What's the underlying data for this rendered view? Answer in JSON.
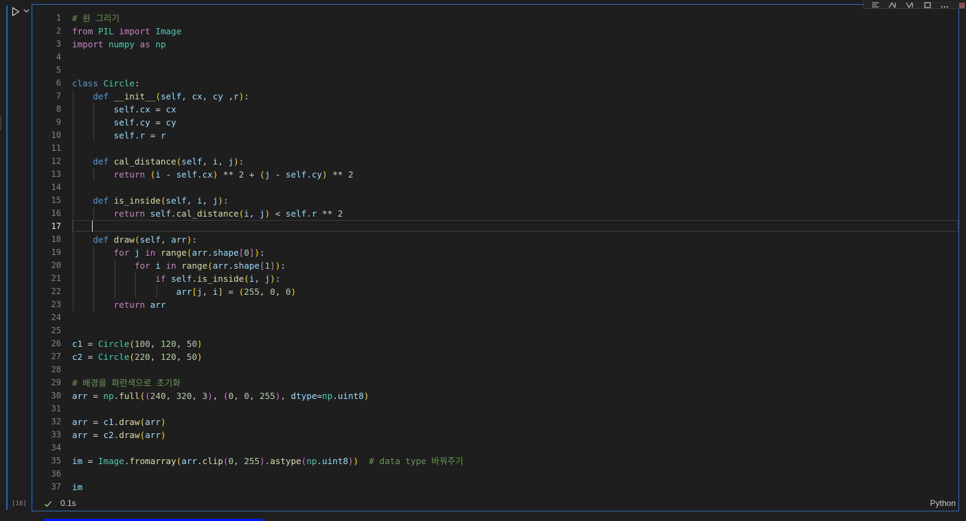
{
  "cell": {
    "execution_count": "[18]",
    "timing": "0.1s",
    "language": "Python",
    "active_line": 17
  },
  "toolbar": {
    "icons": [
      "run-by-line-icon",
      "execute-above-icon",
      "execute-below-icon",
      "split-cell-icon",
      "more-actions-icon",
      "delete-cell-icon"
    ]
  },
  "colors": {
    "accent": "#2f6fb5",
    "keyword": "#c586c0",
    "def": "#569cd6",
    "function": "#dcdcaa",
    "class": "#4ec9b0",
    "number": "#b5cea8",
    "comment": "#6a9955",
    "variable": "#9cdcfe",
    "success": "#89d185"
  },
  "code_lines": [
    [
      [
        "cm",
        "# 원 그리기"
      ]
    ],
    [
      [
        "kw",
        "from"
      ],
      [
        "op",
        " "
      ],
      [
        "cl",
        "PIL"
      ],
      [
        "op",
        " "
      ],
      [
        "kw",
        "import"
      ],
      [
        "op",
        " "
      ],
      [
        "cl",
        "Image"
      ]
    ],
    [
      [
        "kw",
        "import"
      ],
      [
        "op",
        " "
      ],
      [
        "cl",
        "numpy"
      ],
      [
        "op",
        " "
      ],
      [
        "kw",
        "as"
      ],
      [
        "op",
        " "
      ],
      [
        "cl",
        "np"
      ]
    ],
    [],
    [],
    [
      [
        "df",
        "class"
      ],
      [
        "op",
        " "
      ],
      [
        "cl",
        "Circle"
      ],
      [
        "op",
        ":"
      ]
    ],
    [
      [
        "op",
        "    "
      ],
      [
        "df",
        "def"
      ],
      [
        "op",
        " "
      ],
      [
        "fn",
        "__init__"
      ],
      [
        "b1",
        "("
      ],
      [
        "sf",
        "self"
      ],
      [
        "op",
        ", "
      ],
      [
        "vr",
        "cx"
      ],
      [
        "op",
        ", "
      ],
      [
        "vr",
        "cy"
      ],
      [
        "op",
        " ,"
      ],
      [
        "vr",
        "r"
      ],
      [
        "b1",
        ")"
      ],
      [
        "op",
        ":"
      ]
    ],
    [
      [
        "op",
        "        "
      ],
      [
        "sf",
        "self"
      ],
      [
        "op",
        "."
      ],
      [
        "vr",
        "cx"
      ],
      [
        "op",
        " = "
      ],
      [
        "vr",
        "cx"
      ]
    ],
    [
      [
        "op",
        "        "
      ],
      [
        "sf",
        "self"
      ],
      [
        "op",
        "."
      ],
      [
        "vr",
        "cy"
      ],
      [
        "op",
        " = "
      ],
      [
        "vr",
        "cy"
      ]
    ],
    [
      [
        "op",
        "        "
      ],
      [
        "sf",
        "self"
      ],
      [
        "op",
        "."
      ],
      [
        "vr",
        "r"
      ],
      [
        "op",
        " = "
      ],
      [
        "vr",
        "r"
      ]
    ],
    [],
    [
      [
        "op",
        "    "
      ],
      [
        "df",
        "def"
      ],
      [
        "op",
        " "
      ],
      [
        "fn",
        "cal_distance"
      ],
      [
        "b1",
        "("
      ],
      [
        "sf",
        "self"
      ],
      [
        "op",
        ", "
      ],
      [
        "vr",
        "i"
      ],
      [
        "op",
        ", "
      ],
      [
        "vr",
        "j"
      ],
      [
        "b1",
        ")"
      ],
      [
        "op",
        ":"
      ]
    ],
    [
      [
        "op",
        "        "
      ],
      [
        "kw",
        "return"
      ],
      [
        "op",
        " "
      ],
      [
        "b1",
        "("
      ],
      [
        "vr",
        "i"
      ],
      [
        "op",
        " - "
      ],
      [
        "sf",
        "self"
      ],
      [
        "op",
        "."
      ],
      [
        "vr",
        "cx"
      ],
      [
        "b1",
        ")"
      ],
      [
        "op",
        " ** "
      ],
      [
        "nm",
        "2"
      ],
      [
        "op",
        " + "
      ],
      [
        "b1",
        "("
      ],
      [
        "vr",
        "j"
      ],
      [
        "op",
        " - "
      ],
      [
        "sf",
        "self"
      ],
      [
        "op",
        "."
      ],
      [
        "vr",
        "cy"
      ],
      [
        "b1",
        ")"
      ],
      [
        "op",
        " ** "
      ],
      [
        "nm",
        "2"
      ]
    ],
    [],
    [
      [
        "op",
        "    "
      ],
      [
        "df",
        "def"
      ],
      [
        "op",
        " "
      ],
      [
        "fn",
        "is_inside"
      ],
      [
        "b1",
        "("
      ],
      [
        "sf",
        "self"
      ],
      [
        "op",
        ", "
      ],
      [
        "vr",
        "i"
      ],
      [
        "op",
        ", "
      ],
      [
        "vr",
        "j"
      ],
      [
        "b1",
        ")"
      ],
      [
        "op",
        ":"
      ]
    ],
    [
      [
        "op",
        "        "
      ],
      [
        "kw",
        "return"
      ],
      [
        "op",
        " "
      ],
      [
        "sf",
        "self"
      ],
      [
        "op",
        "."
      ],
      [
        "fn",
        "cal_distance"
      ],
      [
        "b1",
        "("
      ],
      [
        "vr",
        "i"
      ],
      [
        "op",
        ", "
      ],
      [
        "vr",
        "j"
      ],
      [
        "b1",
        ")"
      ],
      [
        "op",
        " < "
      ],
      [
        "sf",
        "self"
      ],
      [
        "op",
        "."
      ],
      [
        "vr",
        "r"
      ],
      [
        "op",
        " ** "
      ],
      [
        "nm",
        "2"
      ]
    ],
    [],
    [
      [
        "op",
        "    "
      ],
      [
        "df",
        "def"
      ],
      [
        "op",
        " "
      ],
      [
        "fn",
        "draw"
      ],
      [
        "b1",
        "("
      ],
      [
        "sf",
        "self"
      ],
      [
        "op",
        ", "
      ],
      [
        "vr",
        "arr"
      ],
      [
        "b1",
        ")"
      ],
      [
        "op",
        ":"
      ]
    ],
    [
      [
        "op",
        "        "
      ],
      [
        "kw",
        "for"
      ],
      [
        "op",
        " "
      ],
      [
        "vr",
        "j"
      ],
      [
        "op",
        " "
      ],
      [
        "kw",
        "in"
      ],
      [
        "op",
        " "
      ],
      [
        "fn",
        "range"
      ],
      [
        "b1",
        "("
      ],
      [
        "vr",
        "arr"
      ],
      [
        "op",
        "."
      ],
      [
        "vr",
        "shape"
      ],
      [
        "b2",
        "["
      ],
      [
        "nm",
        "0"
      ],
      [
        "b2",
        "]"
      ],
      [
        "b1",
        ")"
      ],
      [
        "op",
        ":"
      ]
    ],
    [
      [
        "op",
        "            "
      ],
      [
        "kw",
        "for"
      ],
      [
        "op",
        " "
      ],
      [
        "vr",
        "i"
      ],
      [
        "op",
        " "
      ],
      [
        "kw",
        "in"
      ],
      [
        "op",
        " "
      ],
      [
        "fn",
        "range"
      ],
      [
        "b1",
        "("
      ],
      [
        "vr",
        "arr"
      ],
      [
        "op",
        "."
      ],
      [
        "vr",
        "shape"
      ],
      [
        "b2",
        "["
      ],
      [
        "nm",
        "1"
      ],
      [
        "b2",
        "]"
      ],
      [
        "b1",
        ")"
      ],
      [
        "op",
        ":"
      ]
    ],
    [
      [
        "op",
        "                "
      ],
      [
        "kw",
        "if"
      ],
      [
        "op",
        " "
      ],
      [
        "sf",
        "self"
      ],
      [
        "op",
        "."
      ],
      [
        "fn",
        "is_inside"
      ],
      [
        "b1",
        "("
      ],
      [
        "vr",
        "i"
      ],
      [
        "op",
        ", "
      ],
      [
        "vr",
        "j"
      ],
      [
        "b1",
        ")"
      ],
      [
        "op",
        ":"
      ]
    ],
    [
      [
        "op",
        "                    "
      ],
      [
        "vr",
        "arr"
      ],
      [
        "b1",
        "["
      ],
      [
        "vr",
        "j"
      ],
      [
        "op",
        ", "
      ],
      [
        "vr",
        "i"
      ],
      [
        "b1",
        "]"
      ],
      [
        "op",
        " = "
      ],
      [
        "b1",
        "("
      ],
      [
        "nm",
        "255"
      ],
      [
        "op",
        ", "
      ],
      [
        "nm",
        "0"
      ],
      [
        "op",
        ", "
      ],
      [
        "nm",
        "0"
      ],
      [
        "b1",
        ")"
      ]
    ],
    [
      [
        "op",
        "        "
      ],
      [
        "kw",
        "return"
      ],
      [
        "op",
        " "
      ],
      [
        "vr",
        "arr"
      ]
    ],
    [],
    [],
    [
      [
        "vr",
        "c1"
      ],
      [
        "op",
        " = "
      ],
      [
        "cl",
        "Circle"
      ],
      [
        "b1",
        "("
      ],
      [
        "nm",
        "100"
      ],
      [
        "op",
        ", "
      ],
      [
        "nm",
        "120"
      ],
      [
        "op",
        ", "
      ],
      [
        "nm",
        "50"
      ],
      [
        "b1",
        ")"
      ]
    ],
    [
      [
        "vr",
        "c2"
      ],
      [
        "op",
        " = "
      ],
      [
        "cl",
        "Circle"
      ],
      [
        "b1",
        "("
      ],
      [
        "nm",
        "220"
      ],
      [
        "op",
        ", "
      ],
      [
        "nm",
        "120"
      ],
      [
        "op",
        ", "
      ],
      [
        "nm",
        "50"
      ],
      [
        "b1",
        ")"
      ]
    ],
    [],
    [
      [
        "cm",
        "# 배경을 파란색으로 초기화"
      ]
    ],
    [
      [
        "vr",
        "arr"
      ],
      [
        "op",
        " = "
      ],
      [
        "cl",
        "np"
      ],
      [
        "op",
        "."
      ],
      [
        "fn",
        "full"
      ],
      [
        "b1",
        "("
      ],
      [
        "b2",
        "("
      ],
      [
        "nm",
        "240"
      ],
      [
        "op",
        ", "
      ],
      [
        "nm",
        "320"
      ],
      [
        "op",
        ", "
      ],
      [
        "nm",
        "3"
      ],
      [
        "b2",
        ")"
      ],
      [
        "op",
        ", "
      ],
      [
        "b2",
        "("
      ],
      [
        "nm",
        "0"
      ],
      [
        "op",
        ", "
      ],
      [
        "nm",
        "0"
      ],
      [
        "op",
        ", "
      ],
      [
        "nm",
        "255"
      ],
      [
        "b2",
        ")"
      ],
      [
        "op",
        ", "
      ],
      [
        "vr",
        "dtype"
      ],
      [
        "op",
        "="
      ],
      [
        "cl",
        "np"
      ],
      [
        "op",
        "."
      ],
      [
        "vr",
        "uint8"
      ],
      [
        "b1",
        ")"
      ]
    ],
    [],
    [
      [
        "vr",
        "arr"
      ],
      [
        "op",
        " = "
      ],
      [
        "vr",
        "c1"
      ],
      [
        "op",
        "."
      ],
      [
        "fn",
        "draw"
      ],
      [
        "b1",
        "("
      ],
      [
        "vr",
        "arr"
      ],
      [
        "b1",
        ")"
      ]
    ],
    [
      [
        "vr",
        "arr"
      ],
      [
        "op",
        " = "
      ],
      [
        "vr",
        "c2"
      ],
      [
        "op",
        "."
      ],
      [
        "fn",
        "draw"
      ],
      [
        "b1",
        "("
      ],
      [
        "vr",
        "arr"
      ],
      [
        "b1",
        ")"
      ]
    ],
    [],
    [
      [
        "vr",
        "im"
      ],
      [
        "op",
        " = "
      ],
      [
        "cl",
        "Image"
      ],
      [
        "op",
        "."
      ],
      [
        "fn",
        "fromarray"
      ],
      [
        "b1",
        "("
      ],
      [
        "vr",
        "arr"
      ],
      [
        "op",
        "."
      ],
      [
        "fn",
        "clip"
      ],
      [
        "b2",
        "("
      ],
      [
        "nm",
        "0"
      ],
      [
        "op",
        ", "
      ],
      [
        "nm",
        "255"
      ],
      [
        "b2",
        ")"
      ],
      [
        "op",
        "."
      ],
      [
        "fn",
        "astype"
      ],
      [
        "b2",
        "("
      ],
      [
        "cl",
        "np"
      ],
      [
        "op",
        "."
      ],
      [
        "vr",
        "uint8"
      ],
      [
        "b2",
        ")"
      ],
      [
        "b1",
        ")"
      ],
      [
        "op",
        "  "
      ],
      [
        "cm",
        "# data type 바꿔주기"
      ]
    ],
    [],
    [
      [
        "vr",
        "im"
      ]
    ]
  ]
}
